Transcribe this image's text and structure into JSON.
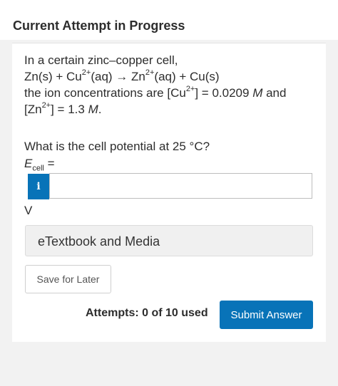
{
  "header": {
    "title": "Current Attempt in Progress"
  },
  "question": {
    "line1": "In a certain zinc–copper cell,",
    "eq_zn": "Zn(s) + Cu",
    "eq_sup1": "2+",
    "eq_mid1": "(aq) → Zn",
    "eq_sup2": "2+",
    "eq_mid2": "(aq) + Cu(s)",
    "line3_a": "the ion concentrations are [Cu",
    "line3_sup": "2+",
    "line3_b": "] = 0.0209 ",
    "line3_unit": "M",
    "line3_c": " and",
    "line4_a": "[Zn",
    "line4_sup": "2+",
    "line4_b": "] = 1.3 ",
    "line4_unit": "M",
    "line4_c": ".",
    "prompt": "What is the cell potential at 25 °C?",
    "ecell_E": "E",
    "ecell_sub": "cell",
    "ecell_eq": " ="
  },
  "answer": {
    "info_icon": "i",
    "value": "",
    "unit": "V"
  },
  "buttons": {
    "etextbook": "eTextbook and Media",
    "save": "Save for Later",
    "submit": "Submit Answer"
  },
  "attempts": "Attempts: 0 of 10 used",
  "colors": {
    "accent": "#0873b8"
  }
}
